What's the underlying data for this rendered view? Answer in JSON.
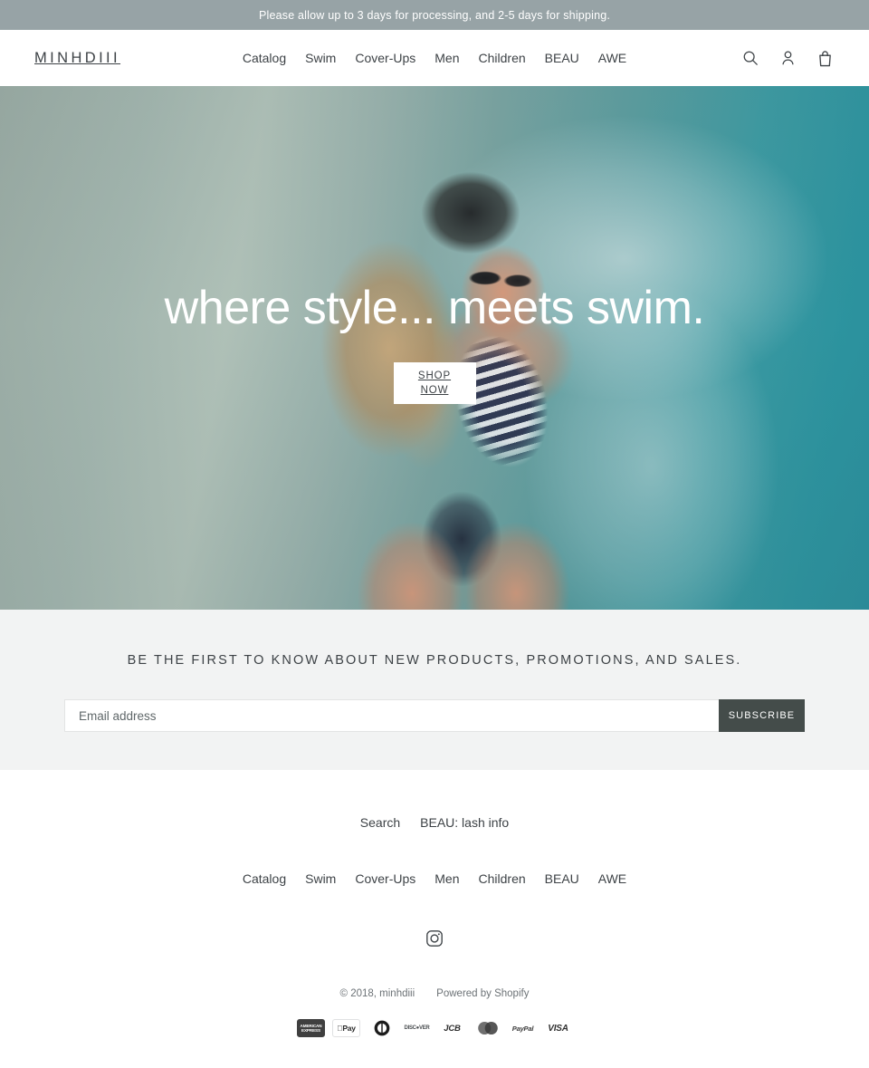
{
  "announcement": {
    "text": "Please allow up to 3 days for processing, and 2-5 days for shipping."
  },
  "header": {
    "logo": "MINHDIII",
    "nav": [
      {
        "label": "Catalog"
      },
      {
        "label": "Swim"
      },
      {
        "label": "Cover-Ups"
      },
      {
        "label": "Men"
      },
      {
        "label": "Children"
      },
      {
        "label": "BEAU"
      },
      {
        "label": "AWE"
      }
    ],
    "icons": [
      {
        "name": "search-icon",
        "label": "Search"
      },
      {
        "name": "account-icon",
        "label": "Log in"
      },
      {
        "name": "cart-icon",
        "label": "Cart"
      }
    ]
  },
  "hero": {
    "title": "where style... meets swim.",
    "cta_line1": "SHOP",
    "cta_line2": "NOW",
    "image_description": "Woman in navy and white striped one-piece swimsuit sitting on beach sand at the water's edge with turquoise surf"
  },
  "newsletter": {
    "title": "BE THE FIRST TO KNOW ABOUT NEW PRODUCTS, PROMOTIONS, AND SALES.",
    "email_placeholder": "Email address",
    "email_value": "",
    "submit_label": "SUBSCRIBE"
  },
  "footer": {
    "links": [
      {
        "label": "Search"
      },
      {
        "label": "BEAU: lash info"
      }
    ],
    "nav": [
      {
        "label": "Catalog"
      },
      {
        "label": "Swim"
      },
      {
        "label": "Cover-Ups"
      },
      {
        "label": "Men"
      },
      {
        "label": "Children"
      },
      {
        "label": "BEAU"
      },
      {
        "label": "AWE"
      }
    ],
    "social": [
      {
        "name": "instagram-icon",
        "label": "Instagram"
      }
    ],
    "copyright": "© 2018, minhdiii",
    "powered_by": "Powered by Shopify",
    "payment_methods": [
      {
        "name": "american-express",
        "label": "AMERICAN EXPRESS"
      },
      {
        "name": "apple-pay",
        "label": "Pay"
      },
      {
        "name": "diners-club",
        "label": "Diners Club"
      },
      {
        "name": "discover",
        "label": "DISCOVER"
      },
      {
        "name": "jcb",
        "label": "JCB"
      },
      {
        "name": "mastercard",
        "label": "Mastercard"
      },
      {
        "name": "paypal",
        "label": "PayPal"
      },
      {
        "name": "visa",
        "label": "VISA"
      }
    ]
  },
  "colors": {
    "announcement_bg": "#97a3a6",
    "text": "#3d4246",
    "newsletter_bg": "#f2f3f3",
    "subscribe_bg": "#444c4a",
    "hero_water": "#2e98a3"
  }
}
